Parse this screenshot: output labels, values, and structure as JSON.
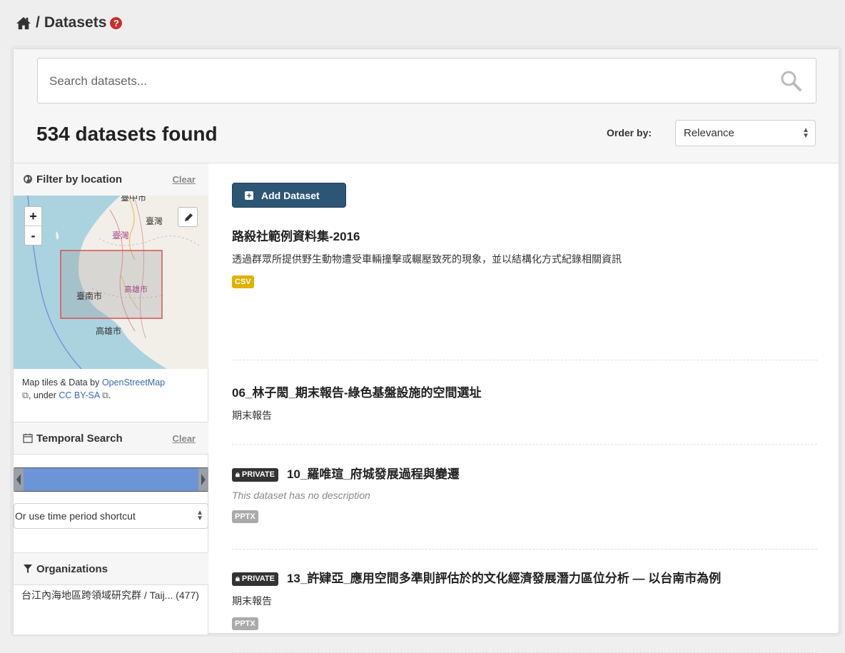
{
  "breadcrumb": {
    "home_icon": "home-icon",
    "separator": "/",
    "current": "Datasets",
    "help_icon": "question-circle-icon",
    "help_glyph": "?"
  },
  "search": {
    "placeholder": "Search datasets...",
    "icon": "search-icon"
  },
  "results": {
    "count_text": "534 datasets found"
  },
  "order": {
    "label": "Order by:",
    "selected": "Relevance"
  },
  "sidebar": {
    "location": {
      "title": "Filter by location",
      "clear": "Clear",
      "icon": "globe-icon"
    },
    "map": {
      "zoom_in": "+",
      "zoom_out": "-",
      "place_labels": [
        "臺中市",
        "臺灣",
        "臺灣",
        "臺南市",
        "高雄市",
        "高雄市"
      ],
      "attribution_prefix": "Map tiles & Data by ",
      "attribution_link1": "OpenStreetMap",
      "attribution_mid": ", under ",
      "attribution_link2": "CC BY-SA",
      "attribution_suffix": "."
    },
    "temporal": {
      "title": "Temporal Search",
      "clear": "Clear",
      "icon": "calendar-icon"
    },
    "time_shortcut": {
      "selected": "Or use time period shortcut"
    },
    "organizations": {
      "title": "Organizations",
      "icon": "filter-icon",
      "first_item": "台江內海地區跨領域研究群 / Taij... (477)"
    }
  },
  "main": {
    "add_button": "Add Dataset",
    "datasets": [
      {
        "title": "路殺社範例資料集-2016",
        "private": false,
        "description": "透過群眾所提供野生動物遭受車輛撞擊或輾壓致死的現象，並以結構化方式紀錄相關資訊",
        "format": "CSV"
      },
      {
        "title": "06_林子閎_期末報告-綠色基盤設施的空間選址",
        "private": false,
        "description": "期末報告",
        "format": ""
      },
      {
        "title": "10_羅唯瑄_府城發展過程與變遷",
        "private": true,
        "private_label": "PRIVATE",
        "description": "This dataset has no description",
        "format": "PPTX"
      },
      {
        "title": "13_許肄亞_應用空間多準則評估於的文化經濟發展潛力區位分析 — 以台南市為例",
        "private": true,
        "private_label": "PRIVATE",
        "description": "期末報告",
        "format": "PPTX"
      }
    ]
  },
  "colors": {
    "primary_button": "#2d5674",
    "csv_badge": "#dfb100",
    "pptx_badge": "#aaaaaa",
    "private_badge": "#333333",
    "help": "#c9302c"
  }
}
